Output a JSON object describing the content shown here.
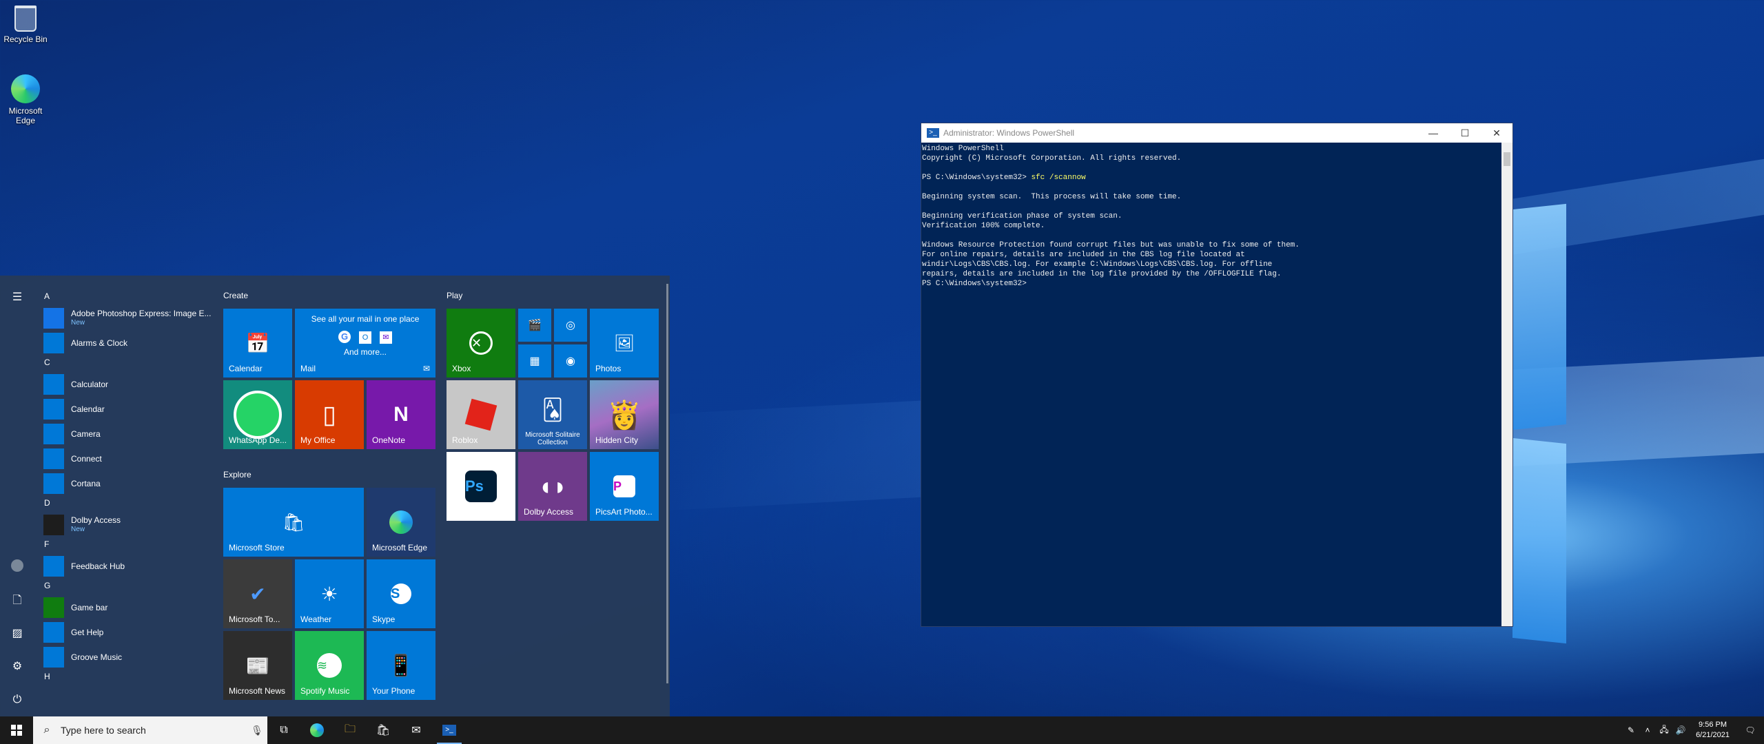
{
  "desktop": {
    "icons": [
      {
        "label": "Recycle Bin"
      },
      {
        "label": "Microsoft Edge"
      }
    ]
  },
  "start_menu": {
    "app_list": [
      {
        "type": "letter",
        "text": "A"
      },
      {
        "type": "app",
        "label": "Adobe Photoshop Express: Image E...",
        "badge": "New",
        "icon": "photoshop-express-icon",
        "color": "#1473e6"
      },
      {
        "type": "app",
        "label": "Alarms & Clock",
        "icon": "alarm-clock-icon",
        "color": "#0078d7"
      },
      {
        "type": "letter",
        "text": "C"
      },
      {
        "type": "app",
        "label": "Calculator",
        "icon": "calculator-icon",
        "color": "#0078d7"
      },
      {
        "type": "app",
        "label": "Calendar",
        "icon": "calendar-icon",
        "color": "#0078d7"
      },
      {
        "type": "app",
        "label": "Camera",
        "icon": "camera-icon",
        "color": "#0078d7"
      },
      {
        "type": "app",
        "label": "Connect",
        "icon": "connect-icon",
        "color": "#0078d7"
      },
      {
        "type": "app",
        "label": "Cortana",
        "icon": "cortana-icon",
        "color": "#0078d7"
      },
      {
        "type": "letter",
        "text": "D"
      },
      {
        "type": "app",
        "label": "Dolby Access",
        "badge": "New",
        "icon": "dolby-icon",
        "color": "#1d1d1d"
      },
      {
        "type": "letter",
        "text": "F"
      },
      {
        "type": "app",
        "label": "Feedback Hub",
        "icon": "feedback-icon",
        "color": "#0078d7"
      },
      {
        "type": "letter",
        "text": "G"
      },
      {
        "type": "app",
        "label": "Game bar",
        "icon": "game-bar-icon",
        "color": "#107c10"
      },
      {
        "type": "app",
        "label": "Get Help",
        "icon": "get-help-icon",
        "color": "#0078d7"
      },
      {
        "type": "app",
        "label": "Groove Music",
        "icon": "groove-music-icon",
        "color": "#0078d7"
      },
      {
        "type": "letter",
        "text": "H"
      }
    ],
    "groups": {
      "create": "Create",
      "play": "Play",
      "explore": "Explore"
    },
    "tiles": {
      "calendar": "Calendar",
      "mail": "Mail",
      "mail_heading": "See all your mail in one place",
      "mail_more": "And more...",
      "whatsapp": "WhatsApp De...",
      "my_office": "My Office",
      "onenote": "OneNote",
      "xbox": "Xbox",
      "photos": "Photos",
      "roblox": "Roblox",
      "solitaire": "Microsoft Solitaire Collection",
      "hidden_city": "Hidden City",
      "photoshop": "",
      "dolby": "Dolby Access",
      "picsart": "PicsArt Photo...",
      "ms_store": "Microsoft Store",
      "ms_edge": "Microsoft Edge",
      "ms_todo": "Microsoft To...",
      "weather": "Weather",
      "skype": "Skype",
      "ms_news": "Microsoft News",
      "spotify": "Spotify Music",
      "your_phone": "Your Phone"
    }
  },
  "powershell": {
    "title": "Administrator: Windows PowerShell",
    "lines": [
      "Windows PowerShell",
      "Copyright (C) Microsoft Corporation. All rights reserved.",
      "",
      "",
      "",
      "Beginning system scan.  This process will take some time.",
      "",
      "Beginning verification phase of system scan.",
      "Verification 100% complete.",
      "",
      "Windows Resource Protection found corrupt files but was unable to fix some of them.",
      "For online repairs, details are included in the CBS log file located at",
      "windir\\Logs\\CBS\\CBS.log. For example C:\\Windows\\Logs\\CBS\\CBS.log. For offline",
      "repairs, details are included in the log file provided by the /OFFLOGFILE flag.",
      "PS C:\\Windows\\system32>"
    ],
    "prompt": "PS C:\\Windows\\system32> ",
    "command": "sfc /scannow"
  },
  "taskbar": {
    "search_placeholder": "Type here to search",
    "time": "9:56 PM",
    "date": "6/21/2021"
  }
}
